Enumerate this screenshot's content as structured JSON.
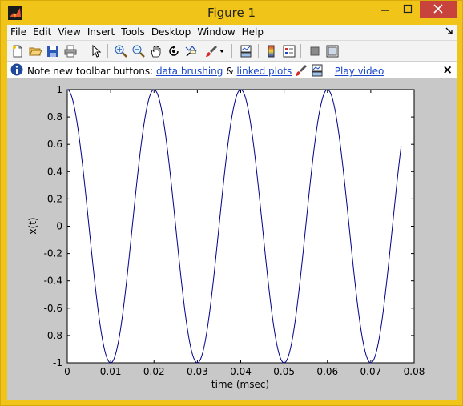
{
  "window": {
    "title": "Figure 1",
    "icons": [
      "matlab-logo-icon",
      "minimize-icon",
      "maximize-icon",
      "close-icon"
    ]
  },
  "menubar": {
    "items": [
      "File",
      "Edit",
      "View",
      "Insert",
      "Tools",
      "Desktop",
      "Window",
      "Help"
    ]
  },
  "toolbar": {
    "buttons": [
      "new-figure-icon",
      "open-file-icon",
      "save-icon",
      "print-icon",
      "edit-plot-arrow-icon",
      "zoom-in-icon",
      "zoom-out-icon",
      "pan-hand-icon",
      "rotate-3d-icon",
      "data-cursor-icon",
      "brush-icon",
      "brush-dropdown-icon",
      "link-plot-icon",
      "insert-colorbar-icon",
      "insert-legend-icon",
      "hide-plot-tools-icon",
      "show-plot-tools-icon"
    ]
  },
  "infobar": {
    "prefix": "Note new toolbar buttons:",
    "link1": "data brushing",
    "amp": "&",
    "link2": "linked plots",
    "link3": "Play video",
    "close": "×"
  },
  "colors": {
    "frame": "#f0c419",
    "client_bg": "#c8c8c8",
    "line": "#00008b",
    "link": "#1a47c9",
    "close_button": "#c7433b"
  },
  "chart_data": {
    "type": "line",
    "title": "",
    "xlabel": "time (msec)",
    "ylabel": "x(t)",
    "xlim": [
      0,
      0.08
    ],
    "ylim": [
      -1,
      1
    ],
    "xticks": [
      "0",
      "0.01",
      "0.02",
      "0.03",
      "0.04",
      "0.05",
      "0.06",
      "0.07",
      "0.08"
    ],
    "yticks": [
      "-1",
      "-0.8",
      "-0.6",
      "-0.4",
      "-0.2",
      "0",
      "0.2",
      "0.4",
      "0.6",
      "0.8",
      "1"
    ],
    "grid": false,
    "series": [
      {
        "color": "#00008b",
        "frequency": 50,
        "x_start": 0,
        "x_end": 0.077,
        "function": "cos(2*pi*50*t)"
      }
    ]
  }
}
